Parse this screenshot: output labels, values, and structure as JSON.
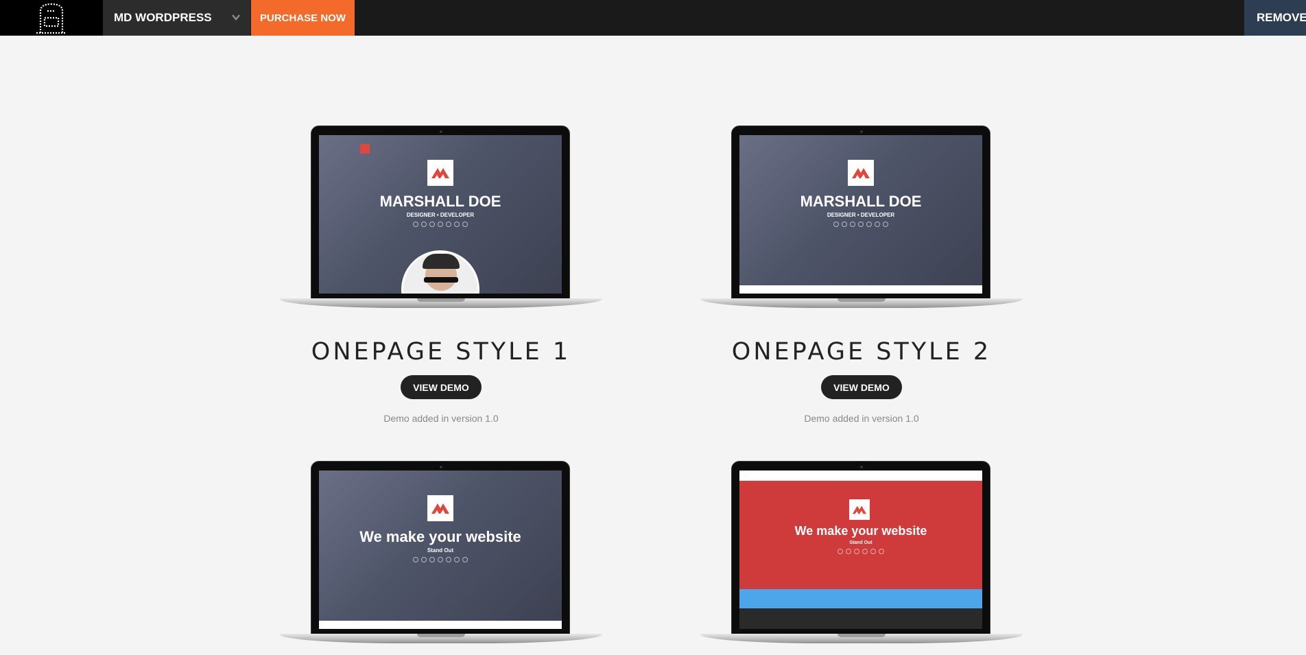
{
  "topbar": {
    "brand_label": "MD WORDPRESS",
    "purchase_label": "PURCHASE NOW",
    "remove_label": "REMOVE"
  },
  "demos": [
    {
      "title": "ONEPAGE STYLE 1",
      "button": "VIEW DEMO",
      "version": "Demo added in version 1.0",
      "screen": {
        "heading": "MARSHALL DOE",
        "sub": "DESIGNER • DEVELOPER"
      }
    },
    {
      "title": "ONEPAGE STYLE 2",
      "button": "VIEW DEMO",
      "version": "Demo added in version 1.0",
      "screen": {
        "heading": "MARSHALL DOE",
        "sub": "DESIGNER • DEVELOPER"
      }
    },
    {
      "screen": {
        "heading": "We make your website",
        "sub": "Stand Out"
      }
    },
    {
      "screen": {
        "heading": "We make your website",
        "sub": "Stand Out"
      }
    }
  ],
  "colors": {
    "accent": "#f36a2a",
    "topbar": "#1a1a1a",
    "remove_bg": "#2d3d52",
    "brand_red": "#e0463c"
  }
}
